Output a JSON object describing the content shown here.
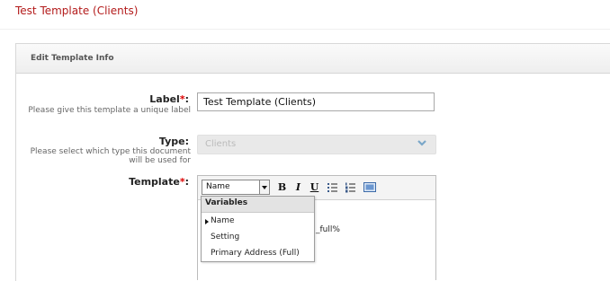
{
  "header": {
    "title": "Test Template (Clients)"
  },
  "panel": {
    "title": "Edit Template Info"
  },
  "form": {
    "label_field": {
      "label": "Label",
      "required_mark": "*",
      "colon": ":",
      "hint": "Please give this template a unique label",
      "value": "Test Template (Clients)"
    },
    "type_field": {
      "label": "Type:",
      "hint": "Please select which type this document will be used for",
      "value": "Clients",
      "disabled": true
    },
    "template_field": {
      "label": "Template",
      "required_mark": "*",
      "colon": ":",
      "toolbar": {
        "format_select_value": "Name",
        "bold": "B",
        "italic": "I",
        "underline": "U"
      },
      "content_fragment": "_full%"
    }
  },
  "variables_menu": {
    "header": "Variables",
    "items": [
      {
        "label": "Name",
        "active": true
      },
      {
        "label": "Setting",
        "active": false
      },
      {
        "label": "Primary Address (Full)",
        "active": false
      }
    ]
  },
  "icons": [
    "chevron-down-icon",
    "bullet-list-icon",
    "numbered-list-icon",
    "image-icon",
    "submenu-caret-icon"
  ],
  "colors": {
    "title": "#b31b1b",
    "required": "#dd0000",
    "disabled_bg": "#e9e9e9",
    "chevron": "#7aa7c9"
  }
}
